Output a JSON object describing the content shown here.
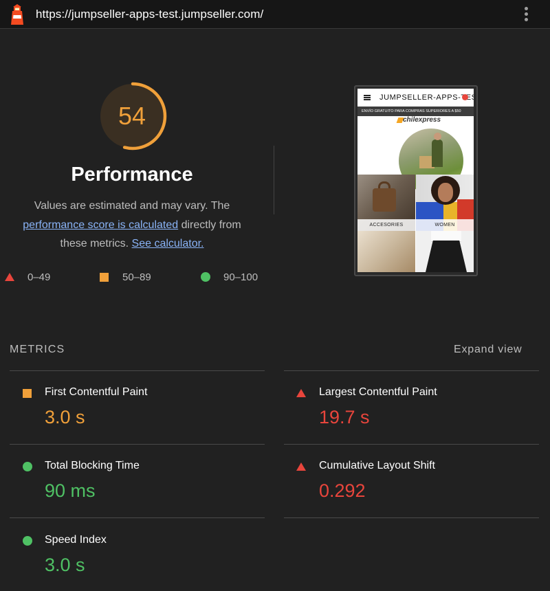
{
  "topbar": {
    "url": "https://jumpseller-apps-test.jumpseller.com/",
    "logo_icon": "lighthouse-icon",
    "menu_icon": "kebab-menu-icon"
  },
  "gauge": {
    "score": "54",
    "score_fraction": 0.54,
    "title": "Performance",
    "color": "#f0a03a"
  },
  "description": {
    "text_1": "Values are estimated and may vary. The ",
    "link_score": "performance score is calculated",
    "text_2": " directly from these metrics. ",
    "link_calculator": "See calculator."
  },
  "legend": {
    "fail": "0–49",
    "average": "50–89",
    "pass": "90–100"
  },
  "screenshot": {
    "site_title": "JUMPSELLER-APPS-TEST",
    "banner": "ENVÍO GRATUITO PARA COMPRAS SUPERIORES A $50",
    "brand": "chilexpress",
    "tile_1": "ACCESORIES",
    "tile_2": "WOMEN"
  },
  "metrics": {
    "title": "METRICS",
    "expand_label": "Expand view",
    "items": [
      {
        "label": "First Contentful Paint",
        "value": "3.0 s",
        "rating": "average"
      },
      {
        "label": "Largest Contentful Paint",
        "value": "19.7 s",
        "rating": "fail"
      },
      {
        "label": "Total Blocking Time",
        "value": "90 ms",
        "rating": "pass"
      },
      {
        "label": "Cumulative Layout Shift",
        "value": "0.292",
        "rating": "fail"
      },
      {
        "label": "Speed Index",
        "value": "3.0 s",
        "rating": "pass"
      }
    ]
  },
  "colors": {
    "fail": "#e8453c",
    "average": "#f0a03a",
    "pass": "#4fc164",
    "link": "#8ab4f8"
  }
}
